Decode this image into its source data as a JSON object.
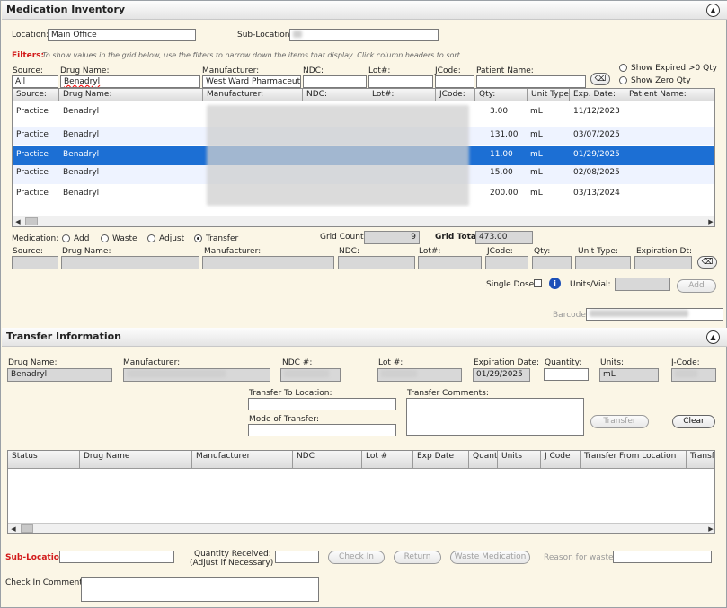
{
  "inventory": {
    "title": "Medication Inventory",
    "location_label": "Location:",
    "location_value": "Main Office",
    "sublocation_label": "Sub-Location:",
    "filters_label": "Filters:",
    "filters_help": "To show values in the grid below, use the filters to narrow down the items that display. Click column headers to sort.",
    "filter_labels": {
      "source": "Source:",
      "drug": "Drug Name:",
      "manufacturer": "Manufacturer:",
      "ndc": "NDC:",
      "lot": "Lot#:",
      "jcode": "JCode:",
      "patient": "Patient Name:"
    },
    "filter_values": {
      "source": "All",
      "drug": "Benadryl",
      "manufacturer": "West Ward Pharmaceutic"
    },
    "show_expired": "Show Expired >0 Qty",
    "show_zero": "Show Zero Qty",
    "columns": [
      "Source:",
      "Drug Name:",
      "Manufacturer:",
      "NDC:",
      "Lot#:",
      "JCode:",
      "Qty:",
      "Unit Type:",
      "Exp. Date:",
      "Patient Name:"
    ],
    "rows": [
      {
        "source": "Practice",
        "drug": "Benadryl",
        "qty": "3.00",
        "unit": "mL",
        "exp": "11/12/2023"
      },
      {
        "source": "Practice",
        "drug": "Benadryl",
        "qty": "131.00",
        "unit": "mL",
        "exp": "03/07/2025"
      },
      {
        "source": "Practice",
        "drug": "Benadryl",
        "qty": "11.00",
        "unit": "mL",
        "exp": "01/29/2025"
      },
      {
        "source": "Practice",
        "drug": "Benadryl",
        "qty": "15.00",
        "unit": "mL",
        "exp": "02/08/2025"
      },
      {
        "source": "Practice",
        "drug": "Benadryl",
        "qty": "200.00",
        "unit": "mL",
        "exp": "03/13/2024"
      }
    ],
    "medication_label": "Medication:",
    "actions": [
      "Add",
      "Waste",
      "Adjust",
      "Transfer"
    ],
    "grid_count_label": "Grid Count:",
    "grid_count": "9",
    "grid_total_label": "Grid Total:",
    "grid_total": "473.00",
    "entry_labels": {
      "source": "Source:",
      "drug": "Drug Name:",
      "manufacturer": "Manufacturer:",
      "ndc": "NDC:",
      "lot": "Lot#:",
      "jcode": "JCode:",
      "qty": "Qty:",
      "unit": "Unit Type:",
      "exp": "Expiration Dt:"
    },
    "single_dose": "Single Dose:",
    "units_vial": "Units/Vial:",
    "add_button": "Add",
    "barcode": "Barcode:"
  },
  "transfer": {
    "title": "Transfer Information",
    "labels": {
      "drug": "Drug Name:",
      "manufacturer": "Manufacturer:",
      "ndc": "NDC #:",
      "lot": "Lot #:",
      "exp": "Expiration Date:",
      "qty": "Quantity:",
      "units": "Units:",
      "jcode": "J-Code:"
    },
    "drug_value": "Benadryl",
    "exp_value": "01/29/2025",
    "units_value": "mL",
    "to_location": "Transfer To Location:",
    "mode": "Mode of Transfer:",
    "comments": "Transfer Comments:",
    "transfer_button": "Transfer",
    "clear_button": "Clear",
    "columns": [
      "Status",
      "Drug Name",
      "Manufacturer",
      "NDC",
      "Lot #",
      "Exp Date",
      "Quanti",
      "Units",
      "J Code",
      "Transfer From Location",
      "Transf"
    ],
    "sublocation": "Sub-Location:",
    "qty_received": "Quantity Received:",
    "qty_adjust": "(Adjust if Necessary)",
    "checkin_button": "Check In",
    "return_button": "Return",
    "waste_button": "Waste Medication",
    "reason": "Reason for waste:",
    "checkin_comments": "Check In Comments:"
  }
}
